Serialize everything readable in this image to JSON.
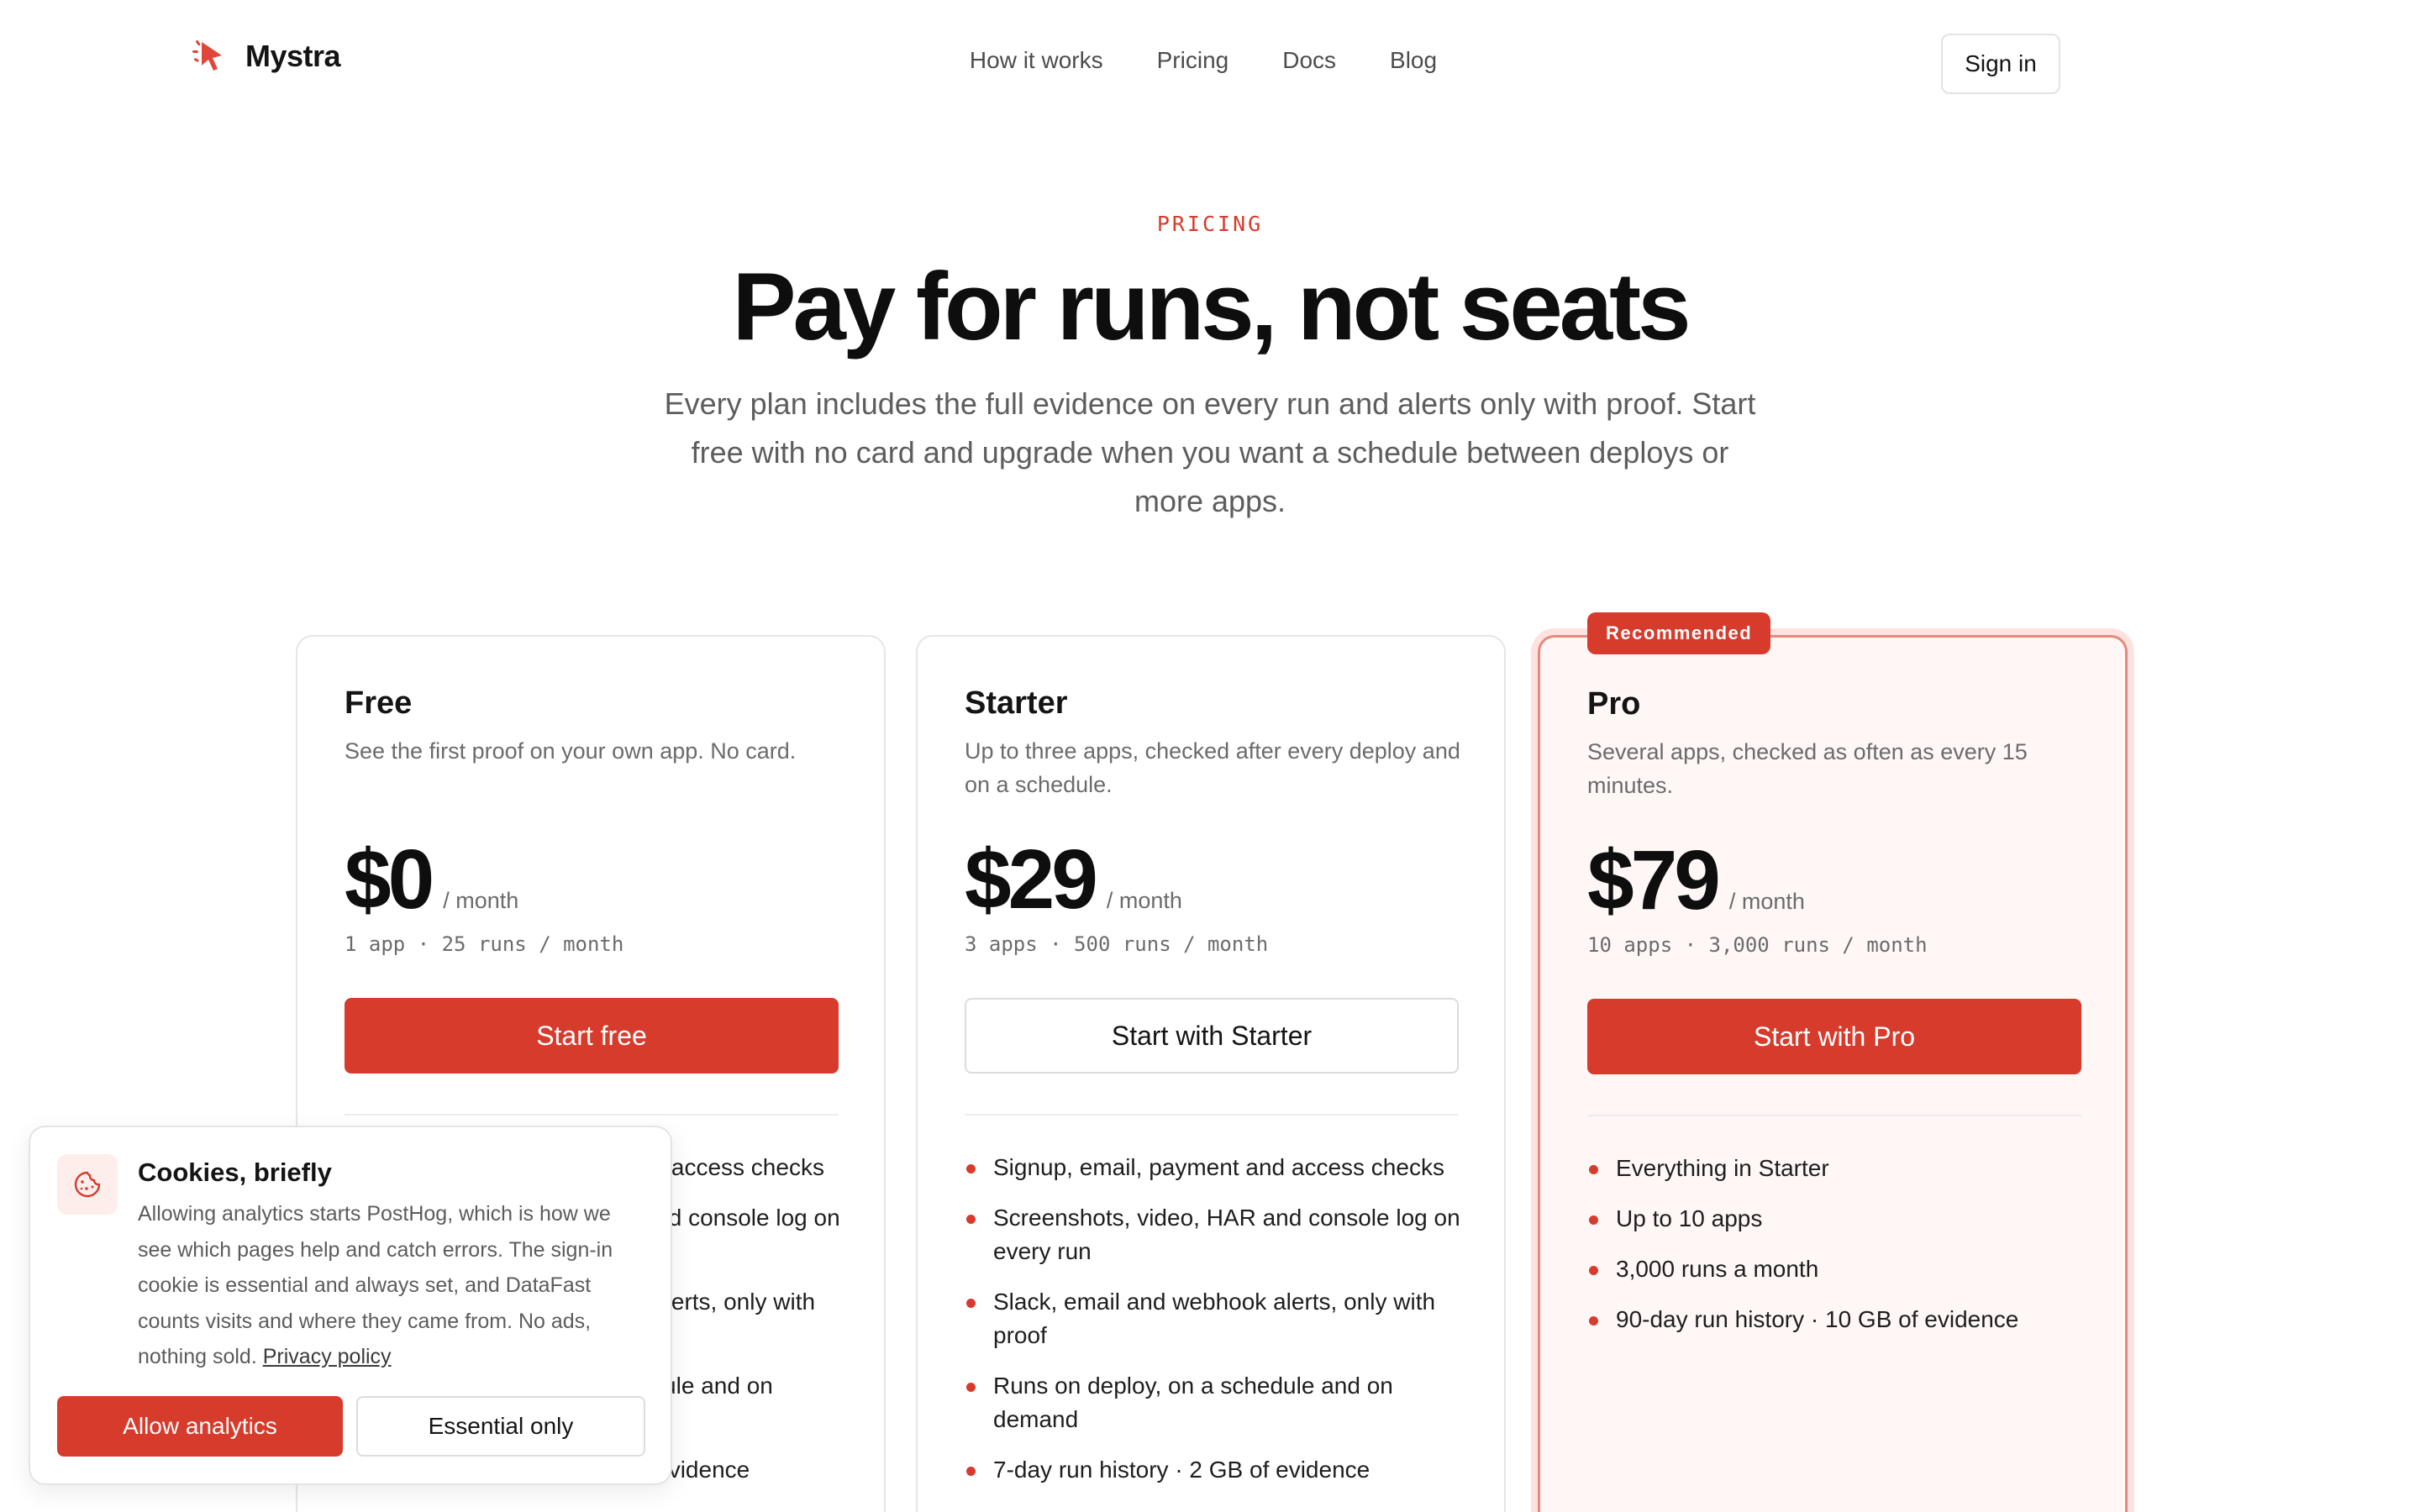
{
  "header": {
    "brand": "Mystra",
    "nav": [
      "How it works",
      "Pricing",
      "Docs",
      "Blog"
    ],
    "sign_in": "Sign in"
  },
  "hero": {
    "eyebrow": "PRICING",
    "title": "Pay for runs, not seats",
    "subtitle": "Every plan includes the full evidence on every run and alerts only with proof. Start free with no card and upgrade when you want a schedule between deploys or more apps."
  },
  "plans": [
    {
      "name": "Free",
      "description": "See the first proof on your own app. No card.",
      "price": "$0",
      "period": "/ month",
      "quota": "1 app · 25 runs / month",
      "cta": "Start free",
      "features": [
        "Signup, email, payment and access checks",
        "Screenshots, video, HAR and console log on every run",
        "Slack, email and webhook alerts, only with proof",
        "Runs on deploy, on a schedule and on demand",
        "7-day run history · 2 GB of evidence"
      ]
    },
    {
      "name": "Starter",
      "description": "Up to three apps, checked after every deploy and on a schedule.",
      "price": "$29",
      "period": "/ month",
      "quota": "3 apps · 500 runs / month",
      "cta": "Start with Starter",
      "features": [
        "Signup, email, payment and access checks",
        "Screenshots, video, HAR and console log on every run",
        "Slack, email and webhook alerts, only with proof",
        "Runs on deploy, on a schedule and on demand",
        "7-day run history · 2 GB of evidence"
      ]
    },
    {
      "name": "Pro",
      "badge": "Recommended",
      "description": "Several apps, checked as often as every 15 minutes.",
      "price": "$79",
      "period": "/ month",
      "quota": "10 apps · 3,000 runs / month",
      "cta": "Start with Pro",
      "features": [
        "Everything in Starter",
        "Up to 10 apps",
        "3,000 runs a month",
        "90-day run history · 10 GB of evidence"
      ]
    }
  ],
  "cookie": {
    "title": "Cookies, briefly",
    "body": "Allowing analytics starts PostHog, which is how we see which pages help and catch errors. The sign-in cookie is essential and always set, and DataFast counts visits and where they came from. No ads, nothing sold.",
    "link": "Privacy policy",
    "allow": "Allow analytics",
    "essential": "Essential only"
  },
  "colors": {
    "accent": "#d63b2c",
    "pro_bg": "#fff7f6",
    "text": "#141414",
    "muted": "#6b6b6b"
  },
  "icons": {
    "logo": "cursor-pointer-icon",
    "cookie": "cookie-icon",
    "bullet": "red-dot-icon"
  }
}
